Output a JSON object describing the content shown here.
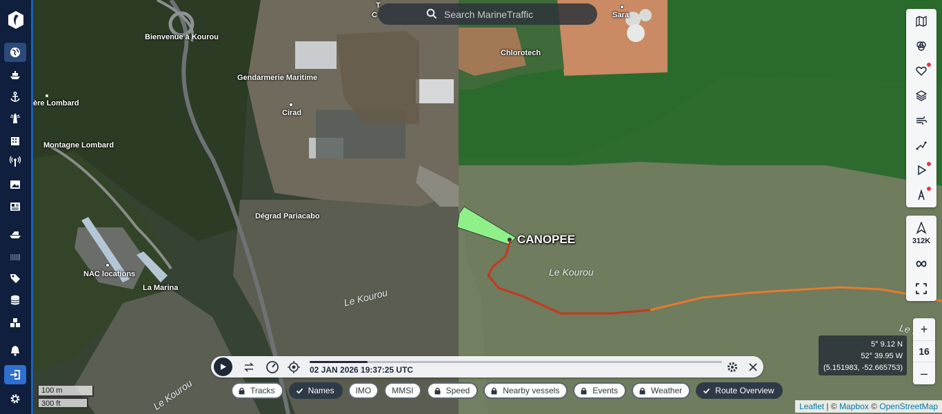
{
  "search": {
    "placeholder": "Search MarineTraffic"
  },
  "nav": {
    "items": [
      {
        "icon": "globe-icon"
      },
      {
        "icon": "ship-icon"
      },
      {
        "icon": "anchor-icon"
      },
      {
        "icon": "lighthouse-icon"
      },
      {
        "icon": "company-icon"
      },
      {
        "icon": "antenna-icon"
      },
      {
        "icon": "photos-icon"
      },
      {
        "icon": "news-icon"
      },
      {
        "icon": "fleet-icon"
      },
      {
        "icon": "container-icon"
      },
      {
        "icon": "tag-icon"
      },
      {
        "icon": "database-icon"
      },
      {
        "icon": "cargo-icon"
      },
      {
        "icon": "bell-icon"
      },
      {
        "icon": "login-icon"
      },
      {
        "icon": "settings-icon"
      }
    ]
  },
  "map": {
    "labels": {
      "bienvenue": "Bienvenue à Kourou",
      "gendarmerie": "Gendarmerie Maritime",
      "cirad": "Cirad",
      "lombard": "ère Lombard",
      "montagne": "Montagne Lombard",
      "degrad": "Dégrad Pariacabo",
      "nac": "NAC locations",
      "lamarina": "La Marina",
      "chlorotech": "Chlorotech",
      "sara": "Sara",
      "top_t": "T",
      "top_c": "C"
    },
    "water_labels": {
      "kourou_1": "Le Kourou",
      "kourou_2": "Le Kourou",
      "kourou_3": "Le Kourou",
      "kourou_4": "Le Kou"
    },
    "vessel": {
      "name": "CANOPEE",
      "color": "#7ef07a",
      "track_colors": [
        "#c8361f",
        "#e87a2c"
      ]
    }
  },
  "right_toolbar": {
    "top": [
      {
        "icon": "map-icon"
      },
      {
        "icon": "layers-filter-icon"
      },
      {
        "icon": "heart-icon",
        "dot": true
      },
      {
        "icon": "stack-icon"
      },
      {
        "icon": "wind-icon"
      },
      {
        "icon": "route-icon"
      },
      {
        "icon": "play-icon",
        "dot": true
      },
      {
        "icon": "compass-icon",
        "dot": true
      }
    ],
    "vessels_count": "312K"
  },
  "zoom": {
    "in": "+",
    "level": "16",
    "out": "–"
  },
  "coords": {
    "lat": "5° 9.12 N",
    "lon": "52° 39.95 W",
    "decimal": "(5.151983, -52.665753)"
  },
  "scale": {
    "metric": "100 m",
    "imperial": "300 ft"
  },
  "playback": {
    "datetime": "02 JAN 2026 19:37:25 UTC",
    "progress": 0.14
  },
  "chips": [
    {
      "label": "Tracks",
      "locked": true,
      "active": false
    },
    {
      "label": "Names",
      "locked": false,
      "active": true
    },
    {
      "label": "IMO",
      "locked": false,
      "active": false
    },
    {
      "label": "MMSI",
      "locked": false,
      "active": false
    },
    {
      "label": "Speed",
      "locked": true,
      "active": false
    },
    {
      "label": "Nearby vessels",
      "locked": true,
      "active": false
    },
    {
      "label": "Events",
      "locked": true,
      "active": false
    },
    {
      "label": "Weather",
      "locked": true,
      "active": false
    },
    {
      "label": "Route Overview",
      "locked": false,
      "active": true
    }
  ],
  "attribution": {
    "leaflet": "Leaflet",
    "sep1": " | © ",
    "mapbox": "Mapbox",
    "sep2": " © ",
    "osm": "OpenStreetMap"
  }
}
